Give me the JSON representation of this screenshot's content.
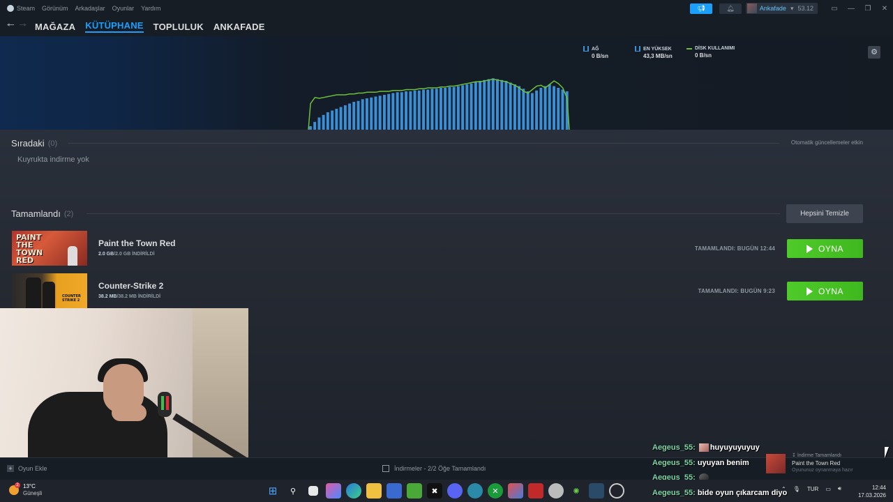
{
  "menu": {
    "items": [
      "Steam",
      "Görünüm",
      "Arkadaşlar",
      "Oyunlar",
      "Yardım"
    ]
  },
  "account": {
    "name": "Ankafade",
    "wallet": "53.12"
  },
  "nav": {
    "tabs": [
      "MAĞAZA",
      "KÜTÜPHANE",
      "TOPLULUK",
      "ANKAFADE"
    ],
    "active_tab": "KÜTÜPHANE"
  },
  "graph": {
    "stats": [
      {
        "label": "AĞ",
        "value": "0 B/sn"
      },
      {
        "label": "EN YÜKSEK",
        "value": "43,3 MB/sn"
      },
      {
        "label": "DİSK KULLANIMI",
        "value": "0 B/sn"
      }
    ],
    "colors": {
      "network": "#3a8fd6",
      "disk": "#6ec03b"
    }
  },
  "chart_data": {
    "type": "bar",
    "series": [
      {
        "name": "AĞ",
        "values": [
          4,
          9,
          14,
          17,
          20,
          22,
          24,
          26,
          28,
          30,
          32,
          33,
          35,
          36,
          37,
          38,
          39,
          40,
          41,
          42,
          43,
          43,
          44,
          44,
          45,
          45,
          46,
          46,
          47,
          47,
          48,
          48,
          49,
          49,
          50,
          51,
          52,
          53,
          55,
          56,
          57,
          58,
          59,
          58,
          57,
          56,
          54,
          52,
          50,
          47,
          44,
          42,
          45,
          48,
          50,
          52,
          50,
          48,
          46,
          44
        ]
      },
      {
        "name": "DİSK KULLANIMI",
        "values": [
          30,
          37,
          36,
          37,
          38,
          39,
          40,
          40,
          40,
          41,
          41,
          42,
          42,
          43,
          43,
          43,
          44,
          44,
          44,
          45,
          45,
          45,
          46,
          46,
          46,
          47,
          47,
          48,
          48,
          48,
          49,
          49,
          50,
          50,
          51,
          52,
          53,
          54,
          55,
          55,
          56,
          57,
          58,
          57,
          56,
          55,
          53,
          51,
          48,
          44,
          42,
          46,
          50,
          51,
          48,
          52,
          56,
          53,
          48,
          36
        ]
      }
    ]
  },
  "queue": {
    "title": "Sıradaki",
    "count": "(0)",
    "auto_updates": "Otomatik güncellemeler etkin",
    "empty_text": "Kuyrukta indirme yok"
  },
  "completed": {
    "title": "Tamamlandı",
    "count": "(2)",
    "clear_all": "Hepsini Temizle",
    "items": [
      {
        "title": "Paint the Town Red",
        "size_done": "2.0 GB",
        "size_total": "/2.0 GB İNDİRİLDİ",
        "completed_at": "TAMAMLANDI: BUGÜN 12:44",
        "play": "OYNA",
        "thumb_text": "PAINT THE TOWN RED"
      },
      {
        "title": "Counter-Strike 2",
        "size_done": "38.2 MB",
        "size_total": "/38.2 MB İNDİRİLDİ",
        "completed_at": "TAMAMLANDI: BUGÜN 9:23",
        "play": "OYNA",
        "thumb_text": "COUNTER STRIKE 2"
      }
    ]
  },
  "bottom": {
    "add_game": "Oyun Ekle",
    "downloads_status": "İndirmeler - 2/2 Öğe Tamamlandı"
  },
  "chat": [
    {
      "user": "Aegeus_55:",
      "text": "huyuyuyuyuy"
    },
    {
      "user": "Aegeus_55:",
      "text": "uyuyan benim"
    },
    {
      "user": "Aegeus_55:",
      "text": ""
    },
    {
      "user": "Aegeus_55:",
      "text": "bide oyun çıkarcam diyo"
    }
  ],
  "toast": {
    "header": "İndirme Tamamlandı",
    "game": "Paint the Town Red",
    "status": "Oyununuz oynanmaya hazır"
  },
  "taskbar": {
    "weather_badge": "2",
    "temperature": "13°C",
    "condition": "Güneşli",
    "language": "TUR",
    "time": "12:44",
    "date": "17.03.2026"
  }
}
